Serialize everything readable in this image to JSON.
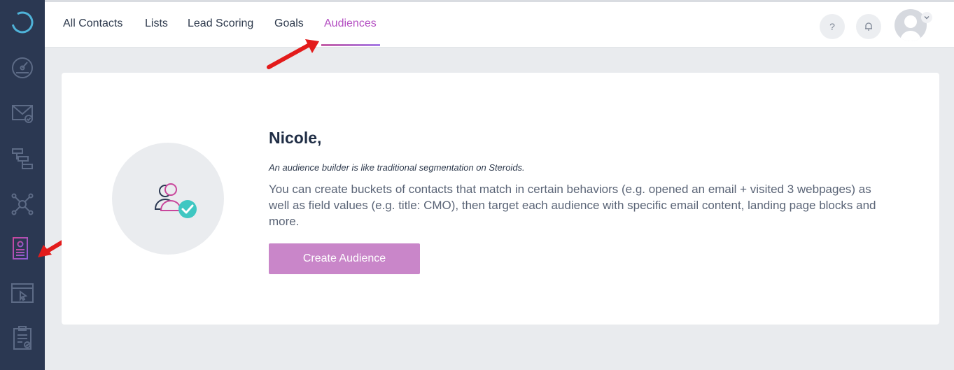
{
  "sidebar": {
    "items": [
      {
        "icon": "logo-ring-icon"
      },
      {
        "icon": "dashboard-gauge-icon"
      },
      {
        "icon": "email-icon"
      },
      {
        "icon": "automation-flow-icon"
      },
      {
        "icon": "integrations-network-icon"
      },
      {
        "icon": "contacts-icon",
        "active": true
      },
      {
        "icon": "landing-page-icon"
      },
      {
        "icon": "tasks-clipboard-icon"
      }
    ]
  },
  "nav": {
    "tabs": [
      {
        "label": "All Contacts"
      },
      {
        "label": "Lists"
      },
      {
        "label": "Lead Scoring"
      },
      {
        "label": "Goals"
      },
      {
        "label": "Audiences",
        "active": true
      }
    ],
    "help_label": "?",
    "help_icon": "question-icon",
    "notifications_icon": "bell-icon",
    "avatar_icon": "user-avatar-icon"
  },
  "main": {
    "greeting": "Nicole,",
    "tagline": "An audience builder is like traditional segmentation on Steroids.",
    "description": "You can create buckets of contacts that match in certain behaviors (e.g. opened an email + visited 3 webpages) as well as field values (e.g. title: CMO), then target each audience with specific email content, landing page blocks and more.",
    "cta_label": "Create Audience",
    "illustration_icon": "audience-group-check-icon"
  },
  "colors": {
    "sidebar_bg": "#2b3852",
    "accent": "#b44fc2",
    "cta_bg": "#c986c9",
    "annotation_arrow": "#e31b1b"
  }
}
